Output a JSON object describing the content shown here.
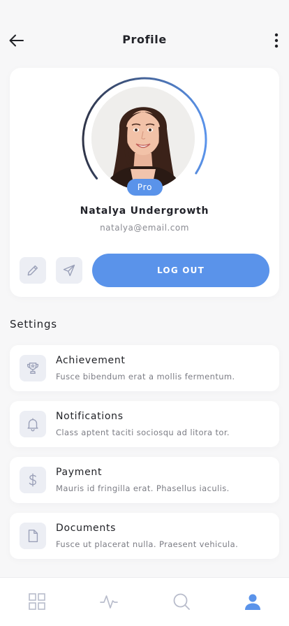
{
  "header": {
    "title": "Profile",
    "back_icon": "arrow-left-icon",
    "more_icon": "more-vertical-icon"
  },
  "profile": {
    "name": "Natalya Undergrowth",
    "email": "natalya@email.com",
    "badge": "Pro",
    "avatar_icon": "user-photo",
    "progress": 0.7,
    "edit_icon": "pencil-icon",
    "send_icon": "send-icon",
    "logout_label": "LOG OUT"
  },
  "settings": {
    "title": "Settings",
    "items": [
      {
        "title": "Achievement",
        "description": "Fusce bibendum erat a mollis fermentum.",
        "icon": "trophy-icon"
      },
      {
        "title": "Notifications",
        "description": "Class aptent taciti sociosqu ad litora tor.",
        "icon": "bell-icon"
      },
      {
        "title": "Payment",
        "description": "Mauris id fringilla erat. Phasellus iaculis.",
        "icon": "dollar-icon"
      },
      {
        "title": "Documents",
        "description": "Fusce ut placerat nulla. Praesent vehicula.",
        "icon": "document-icon"
      }
    ]
  },
  "bottom_nav": {
    "items": [
      {
        "icon": "grid-icon",
        "active": false
      },
      {
        "icon": "activity-icon",
        "active": false
      },
      {
        "icon": "search-icon",
        "active": false
      },
      {
        "icon": "user-icon",
        "active": true
      }
    ]
  },
  "colors": {
    "accent": "#5a93ea",
    "ring_dark": "#2f3448",
    "icon_muted": "#9aa0b8",
    "background": "#f7f7f8"
  }
}
